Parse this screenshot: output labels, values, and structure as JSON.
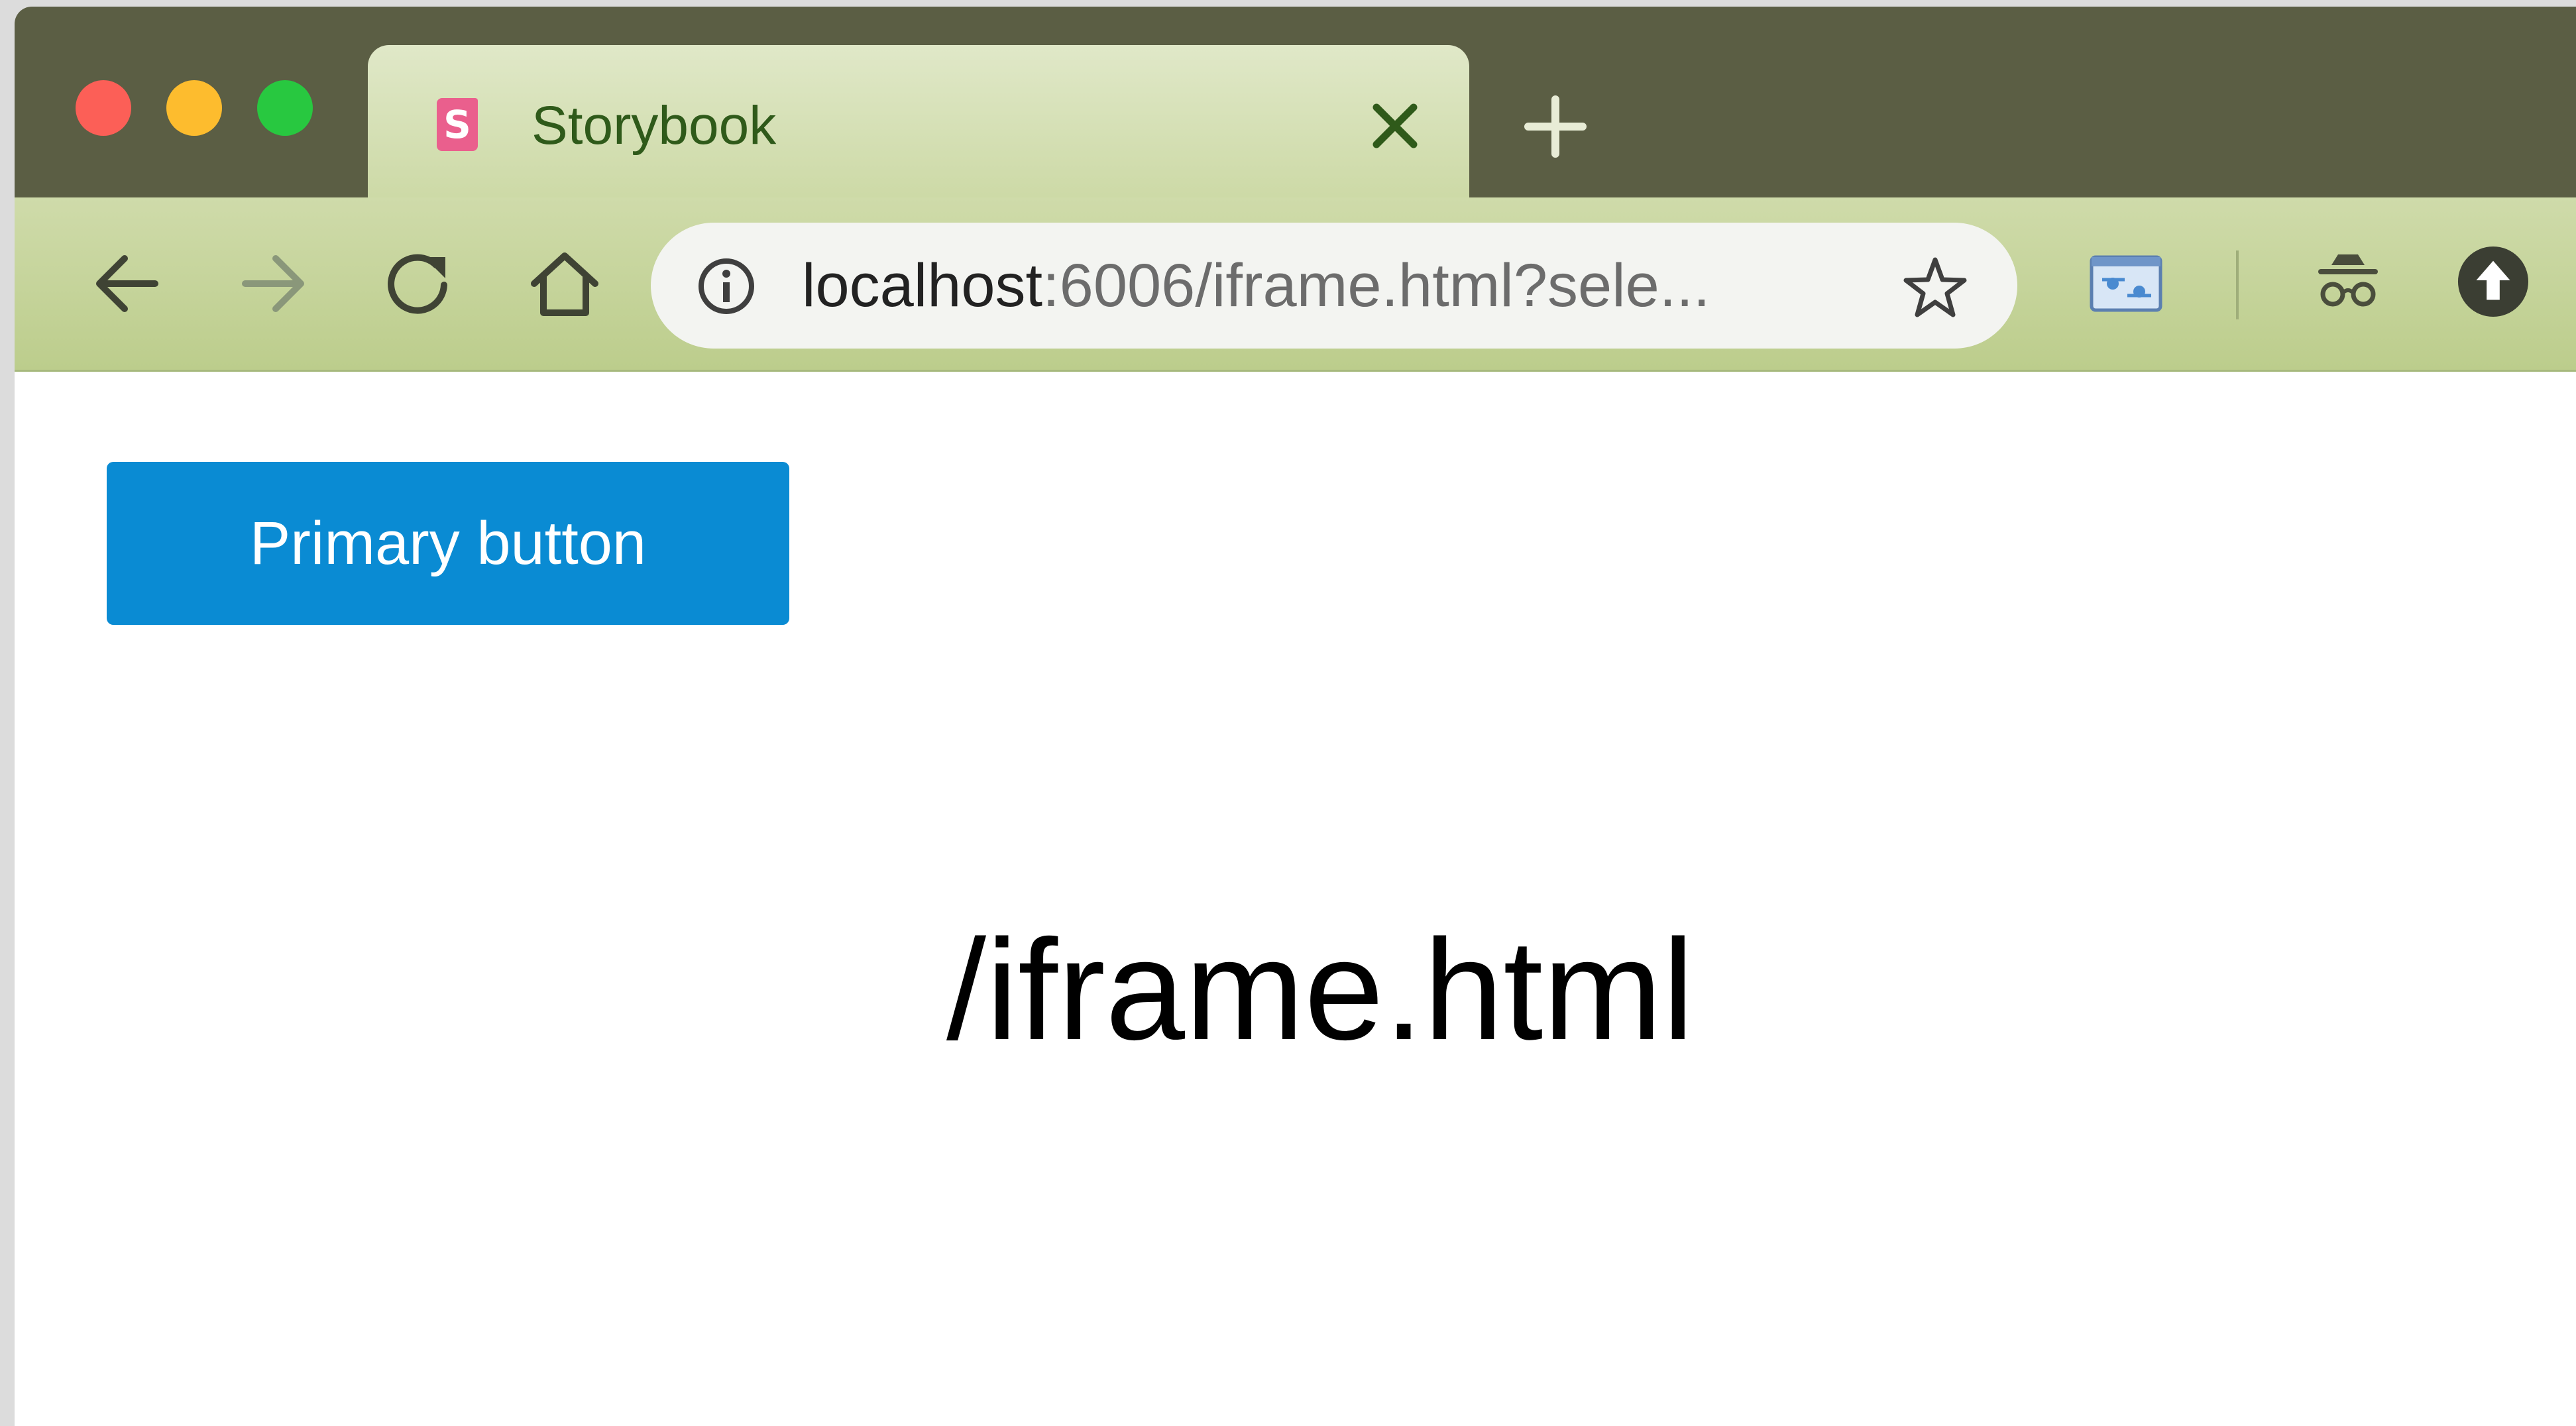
{
  "window": {
    "traffic_lights": {
      "close": "#fc5f57",
      "minimize": "#fdbc2e",
      "zoom": "#28c840"
    }
  },
  "tab": {
    "favicon_letter": "S",
    "favicon_icon": "storybook-icon",
    "title": "Storybook",
    "close_icon": "close-icon",
    "new_tab_icon": "plus-icon"
  },
  "toolbar": {
    "back_icon": "arrow-left-icon",
    "forward_icon": "arrow-right-icon",
    "reload_icon": "reload-icon",
    "home_icon": "home-icon",
    "url_host": "localhost",
    "url_rest": ":6006/iframe.html?sele...",
    "info_icon": "info-icon",
    "bookmark_icon": "star-icon",
    "extensions": [
      "screenshot-extension-icon",
      "incognito-icon",
      "update-icon"
    ]
  },
  "page": {
    "primary_button_label": "Primary button",
    "path_text": "/iframe.html"
  },
  "colors": {
    "titlebar": "#5b5e44",
    "tab": "#d6e0b8",
    "toolbar": "#c6d49b",
    "tab_text": "#2f5a1a",
    "primary_button": "#0a8bd3"
  }
}
